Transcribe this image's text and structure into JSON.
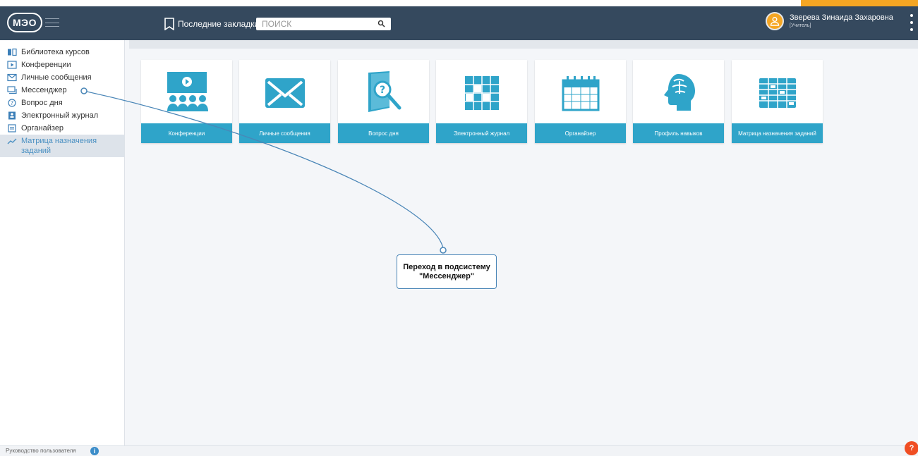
{
  "header": {
    "logo_text": "МЭО",
    "bookmarks_label": "Последние закладки",
    "search_placeholder": "ПОИСК",
    "user_name": "Зверева Зинаида Захаровна",
    "user_role": "[Учитель]"
  },
  "sidebar": {
    "items": [
      {
        "label": "Библиотека курсов",
        "icon": "book-icon"
      },
      {
        "label": "Конференции",
        "icon": "play-icon"
      },
      {
        "label": "Личные сообщения",
        "icon": "envelope-icon"
      },
      {
        "label": "Мессенджер",
        "icon": "chat-icon"
      },
      {
        "label": "Вопрос дня",
        "icon": "question-icon"
      },
      {
        "label": "Электронный журнал",
        "icon": "journal-icon"
      },
      {
        "label": "Органайзер",
        "icon": "organizer-icon"
      },
      {
        "label": "Матрица назначения заданий",
        "icon": "chart-line-icon",
        "active": true
      }
    ],
    "collapse_glyph": "«"
  },
  "tiles": [
    {
      "label": "Конференции",
      "icon": "conference-icon"
    },
    {
      "label": "Личные сообщения",
      "icon": "envelope-icon"
    },
    {
      "label": "Вопрос дня",
      "icon": "question-book-icon"
    },
    {
      "label": "Электронный журнал",
      "icon": "journal-grid-icon"
    },
    {
      "label": "Органайзер",
      "icon": "calendar-icon"
    },
    {
      "label": "Профиль навыков",
      "icon": "brain-icon"
    },
    {
      "label": "Матрица назначения заданий",
      "icon": "matrix-icon"
    }
  ],
  "footer": {
    "guide_label": "Руководство пользователя",
    "info_glyph": "i",
    "help_glyph": "?"
  },
  "callout": {
    "text": "Переход в подсистему \"Мессенджер\""
  },
  "colors": {
    "header_bg": "#35495e",
    "accent": "#2fa4c9",
    "active_bg": "#dde3ea",
    "callout_border": "#4a86b7",
    "help": "#f04e23"
  }
}
